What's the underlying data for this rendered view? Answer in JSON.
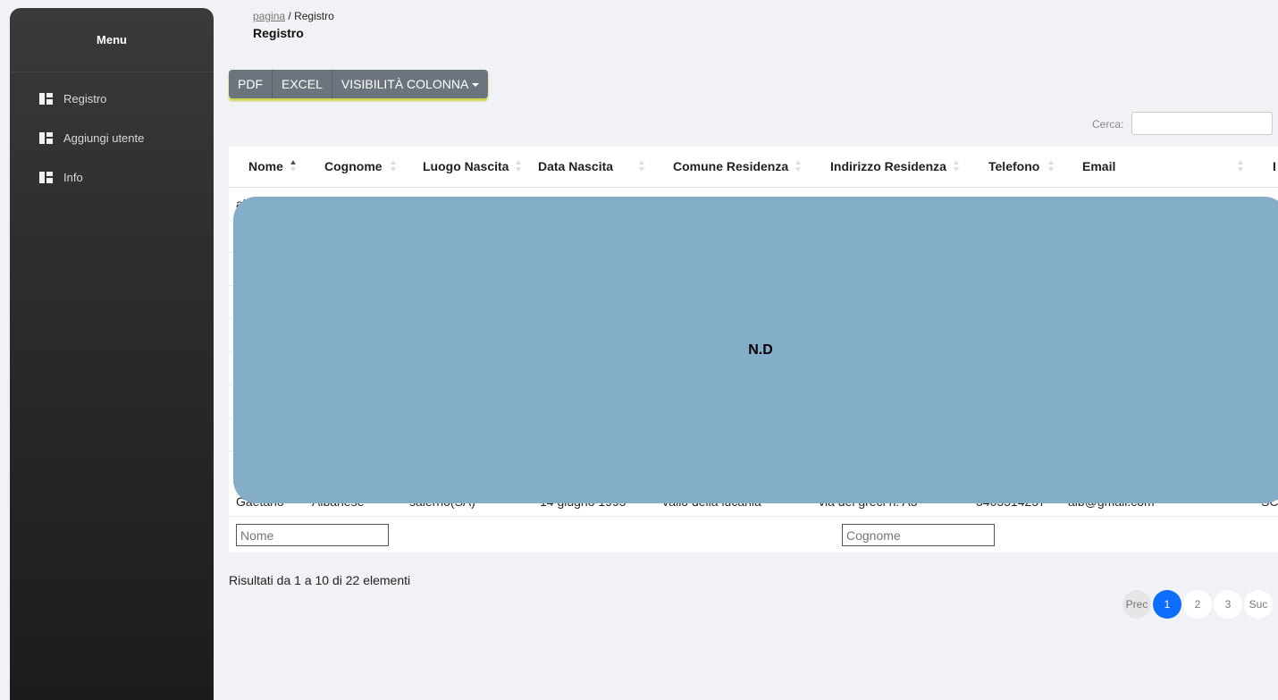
{
  "sidebar": {
    "title": "Menu",
    "items": [
      {
        "label": "Registro",
        "icon": "dashboard-icon"
      },
      {
        "label": "Aggiungi utente",
        "icon": "dashboard-icon"
      },
      {
        "label": "Info",
        "icon": "dashboard-icon"
      }
    ]
  },
  "header": {
    "breadcrumb_link": "pagina",
    "breadcrumb_sep": "/",
    "breadcrumb_current": "Registro",
    "title": "Registro"
  },
  "toolbar": {
    "pdf_label": "PDF",
    "excel_label": "EXCEL",
    "columns_label": "VISIBILITÀ COLONNA"
  },
  "search": {
    "label": "Cerca:",
    "value": ""
  },
  "table": {
    "columns": [
      "Nome",
      "Cognome",
      "Luogo Nascita",
      "Data Nascita",
      "Comune Residenza",
      "Indirizzo Residenza",
      "Telefono",
      "Email",
      "I"
    ],
    "first_row_partial": "all",
    "last_row": {
      "nome": "Gaetano",
      "cognome": "Albanese",
      "luogo_nascita": "salerno(SA)",
      "data_nascita": "14 giugno 1995",
      "comune_residenza": "Vallo della lucania",
      "indirizzo_residenza": "via dei greci n. A3",
      "telefono": "3405514257",
      "email": "alb@gmail.com",
      "extra": "SC"
    },
    "filters": {
      "nome_placeholder": "Nome",
      "cognome_placeholder": "Cognome"
    }
  },
  "overlay": {
    "text": "N.D"
  },
  "footer": {
    "results_text": "Risultati da 1 a 10 di 22 elementi",
    "pagination": {
      "prev": "Prec",
      "pages": [
        "1",
        "2",
        "3"
      ],
      "next": "Suc",
      "current": "1"
    }
  },
  "colors": {
    "accent": "#0d6efd",
    "sidebar": "#2c2c2c",
    "overlay": "#84adc8",
    "button": "#6c757d"
  }
}
